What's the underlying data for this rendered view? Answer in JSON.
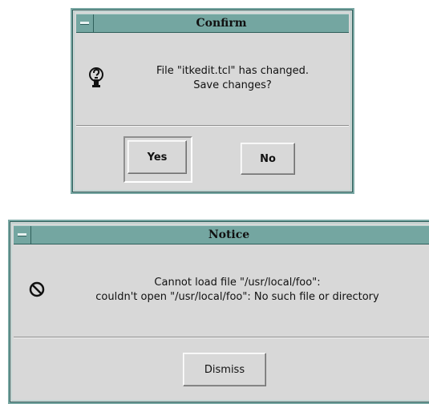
{
  "confirm": {
    "title": "Confirm",
    "message_line1": "File \"itkedit.tcl\" has changed.",
    "message_line2": "Save changes?",
    "yes_label": "Yes",
    "no_label": "No"
  },
  "notice": {
    "title": "Notice",
    "message_line1": "Cannot load file \"/usr/local/foo\":",
    "message_line2": "couldn't open \"/usr/local/foo\": No such file or directory",
    "dismiss_label": "Dismiss"
  },
  "icons": {
    "confirm_icon": "question-icon",
    "notice_icon": "error-icon"
  },
  "colors": {
    "window_frame": "#7aa7a3",
    "titlebar": "#74a6a1",
    "background": "#d8d8d8"
  }
}
